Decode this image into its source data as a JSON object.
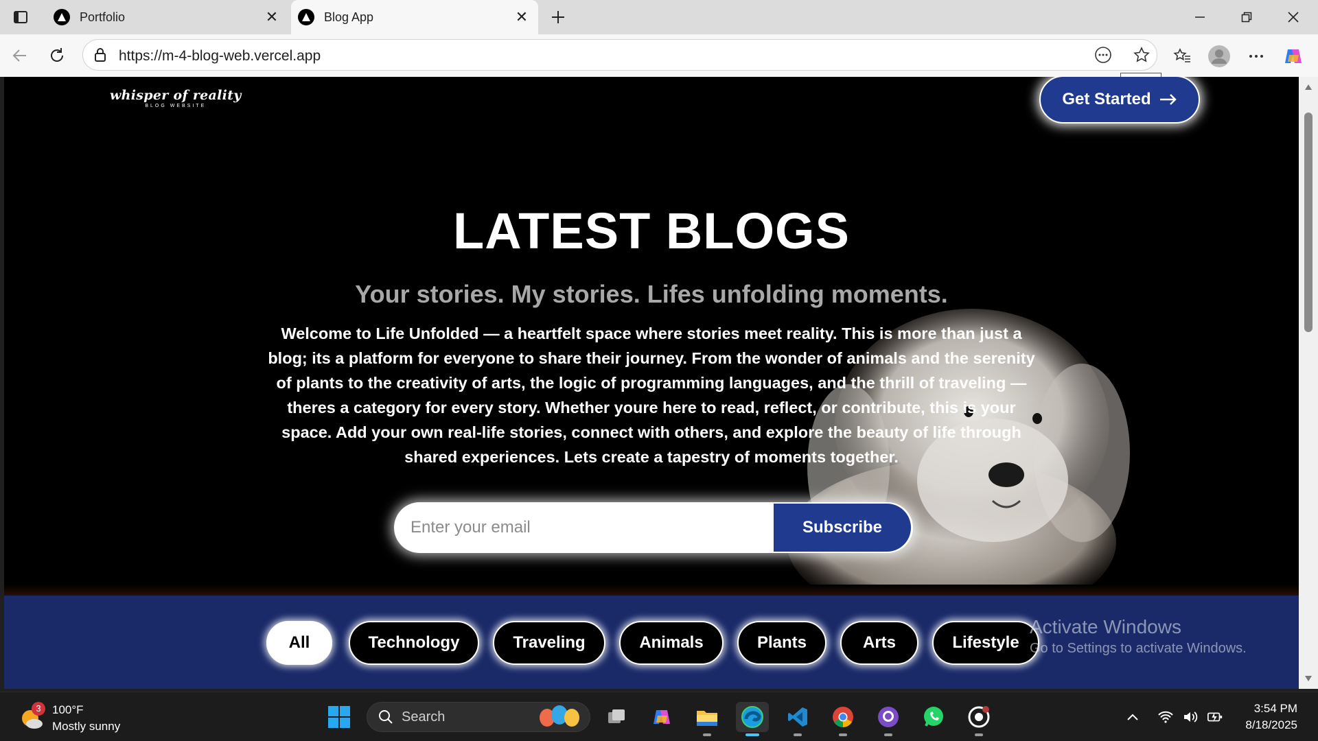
{
  "browser": {
    "tabs": [
      {
        "title": "Portfolio",
        "active": false
      },
      {
        "title": "Blog App",
        "active": true
      }
    ],
    "url": "https://m-4-blog-web.vercel.app",
    "tooltip": "Close"
  },
  "site": {
    "logo_main": "whisper of reality",
    "logo_sub": "BLOG WEBSITE",
    "cta_label": "Get Started",
    "hero": {
      "title": "LATEST BLOGS",
      "subtitle": "Your stories. My stories. Lifes unfolding moments.",
      "description": "Welcome to Life Unfolded — a heartfelt space where stories meet reality. This is more than just a blog; its a platform for everyone to share their journey. From the wonder of animals and the serenity of plants to the creativity of arts, the logic of programming languages, and the thrill of traveling — theres a category for every story. Whether youre here to read, reflect, or contribute, this is your space. Add your own real-life stories, connect with others, and explore the beauty of life through shared experiences. Lets create a tapestry of moments together."
    },
    "subscribe": {
      "placeholder": "Enter your email",
      "value": "",
      "button_label": "Subscribe"
    },
    "categories": [
      {
        "label": "All",
        "active": true
      },
      {
        "label": "Technology",
        "active": false
      },
      {
        "label": "Traveling",
        "active": false
      },
      {
        "label": "Animals",
        "active": false
      },
      {
        "label": "Plants",
        "active": false
      },
      {
        "label": "Arts",
        "active": false
      },
      {
        "label": "Lifestyle",
        "active": false
      }
    ]
  },
  "watermark": {
    "title": "Activate Windows",
    "subtitle": "Go to Settings to activate Windows."
  },
  "taskbar": {
    "weather_temp": "100°F",
    "weather_desc": "Mostly sunny",
    "weather_badge": "3",
    "search_label": "Search",
    "time": "3:54 PM",
    "date": "8/18/2025"
  },
  "colors": {
    "brand_blue": "#1f3a8f",
    "category_bar": "#1a2a68",
    "hero_bg": "#000000"
  }
}
